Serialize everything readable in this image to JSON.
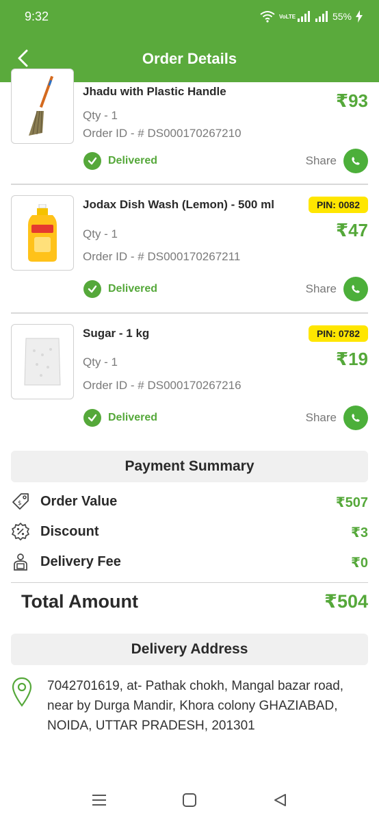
{
  "status_bar": {
    "time": "9:32",
    "carrier": "VoLTE",
    "battery": "55%"
  },
  "header": {
    "title": "Order Details"
  },
  "items": [
    {
      "name": "Jhadu with Plastic Handle",
      "qty": "Qty - 1",
      "order_id": "Order ID - # DS000170267210",
      "price": "₹93",
      "status": "Delivered",
      "share": "Share"
    },
    {
      "name": "Jodax Dish Wash (Lemon) - 500 ml",
      "pin": "PIN: 0082",
      "qty": "Qty - 1",
      "order_id": "Order ID - # DS000170267211",
      "price": "₹47",
      "status": "Delivered",
      "share": "Share"
    },
    {
      "name": "Sugar - 1 kg",
      "pin": "PIN: 0782",
      "qty": "Qty - 1",
      "order_id": "Order ID - # DS000170267216",
      "price": "₹19",
      "status": "Delivered",
      "share": "Share"
    }
  ],
  "payment": {
    "header": "Payment Summary",
    "rows": [
      {
        "label": "Order Value",
        "amount": "₹507",
        "icon": "price-tag-icon"
      },
      {
        "label": "Discount",
        "amount": "₹3",
        "icon": "discount-icon"
      },
      {
        "label": "Delivery Fee",
        "amount": "₹0",
        "icon": "delivery-person-icon"
      }
    ],
    "total_label": "Total Amount",
    "total_amount": "₹504"
  },
  "address": {
    "header": "Delivery Address",
    "line1": "7042701619, at- Pathak chokh, Mangal bazar road,",
    "line2": "near by Durga Mandir, Khora colony  GHAZIABAD,",
    "line3": "NOIDA, UTTAR PRADESH, 201301"
  },
  "colors": {
    "brand_green": "#5aaa3c",
    "accent_green": "#55a83a",
    "pin_yellow": "#ffe600"
  }
}
